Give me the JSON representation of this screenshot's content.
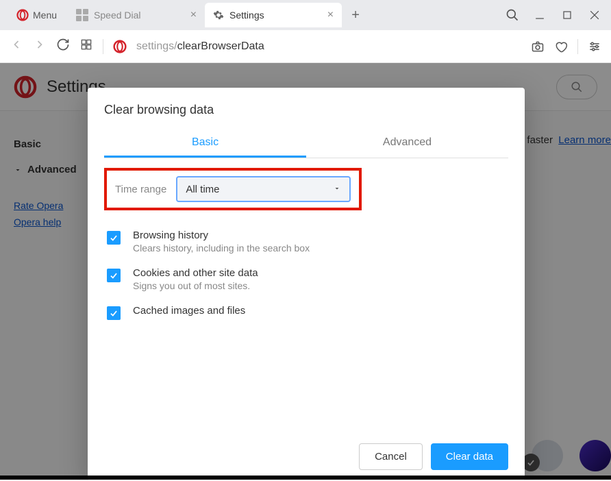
{
  "chrome": {
    "menu_label": "Menu",
    "tabs": [
      {
        "label": "Speed Dial"
      },
      {
        "label": "Settings"
      }
    ],
    "url_prefix": "settings/",
    "url_path": "clearBrowserData"
  },
  "settings_page": {
    "title": "Settings",
    "sidebar": {
      "basic": "Basic",
      "advanced": "Advanced",
      "rate": "Rate Opera",
      "help": "Opera help"
    },
    "faster_text": "faster",
    "learn_more": "Learn more"
  },
  "dialog": {
    "title": "Clear browsing data",
    "tabs": {
      "basic": "Basic",
      "advanced": "Advanced"
    },
    "time_range_label": "Time range",
    "time_range_value": "All time",
    "options": [
      {
        "title": "Browsing history",
        "sub": "Clears history, including in the search box",
        "checked": true
      },
      {
        "title": "Cookies and other site data",
        "sub": "Signs you out of most sites.",
        "checked": true
      },
      {
        "title": "Cached images and files",
        "sub": "",
        "checked": true
      }
    ],
    "cancel": "Cancel",
    "clear": "Clear data"
  }
}
